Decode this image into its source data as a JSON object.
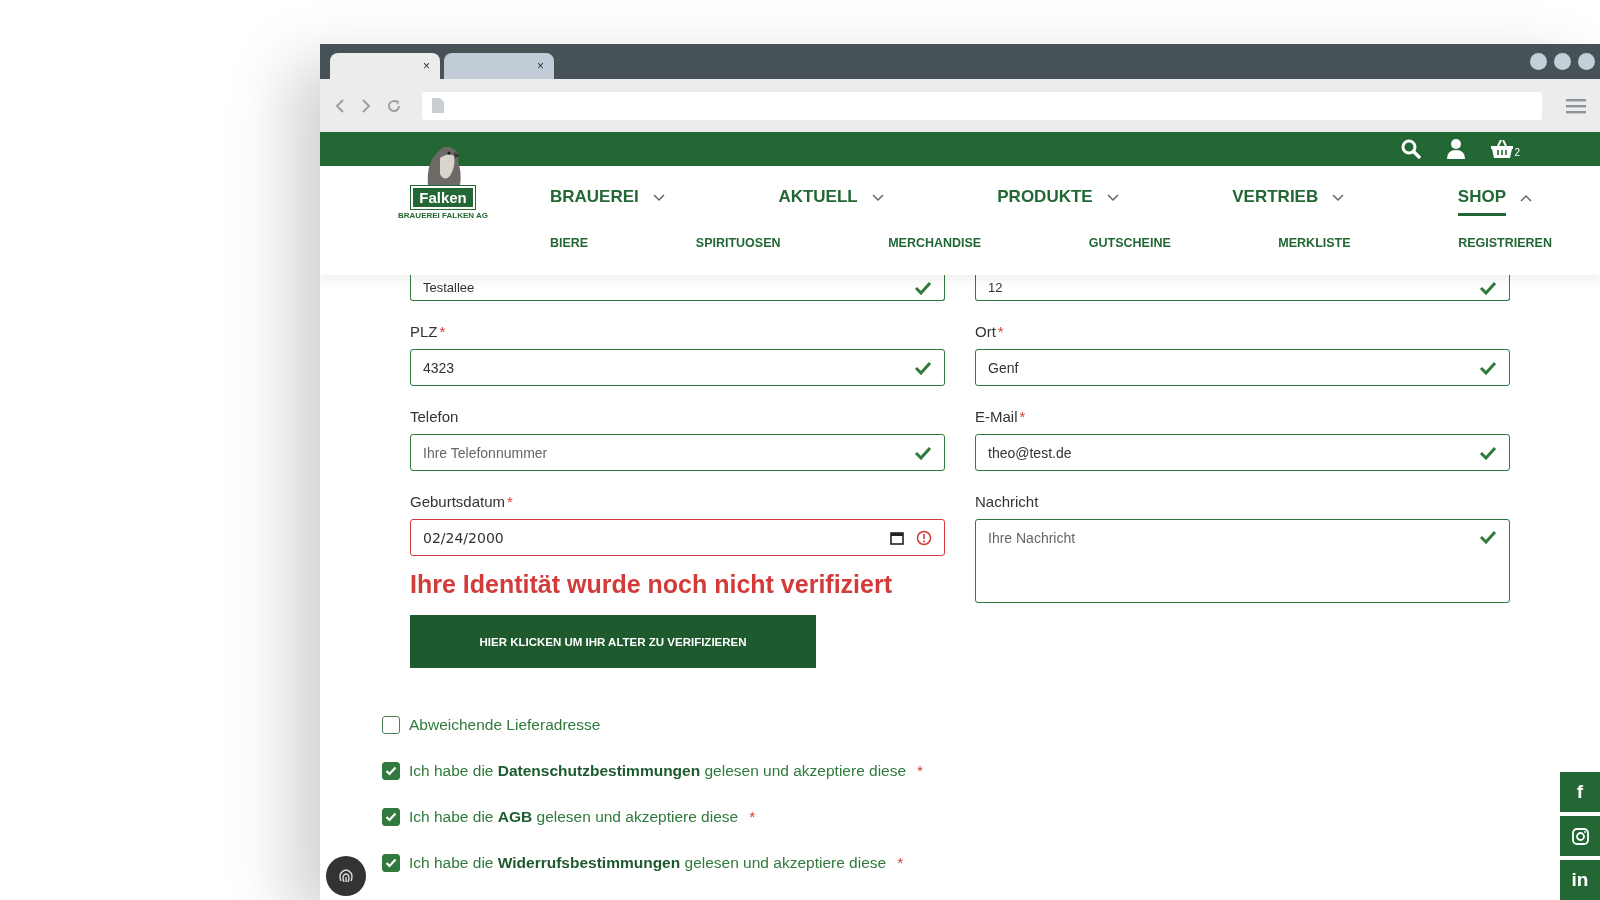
{
  "browser": {
    "tabs": [
      {
        "close": "×",
        "selected": true
      },
      {
        "close": "×",
        "selected": false
      }
    ]
  },
  "topbar": {
    "cart_count": "2"
  },
  "logo": {
    "name": "Falken",
    "subtitle": "BRAUEREI FALKEN AG"
  },
  "nav": [
    {
      "label": "BRAUEREI",
      "expanded": false,
      "selected": false
    },
    {
      "label": "AKTUELL",
      "expanded": false,
      "selected": false
    },
    {
      "label": "PRODUKTE",
      "expanded": false,
      "selected": false
    },
    {
      "label": "VERTRIEB",
      "expanded": false,
      "selected": false
    },
    {
      "label": "SHOP",
      "expanded": true,
      "selected": true
    }
  ],
  "subnav": [
    "BIERE",
    "SPIRITUOSEN",
    "MERCHANDISE",
    "GUTSCHEINE",
    "MERKLISTE",
    "REGISTRIEREN"
  ],
  "fields": [
    {
      "kind": "cut",
      "value": "Testallee",
      "valid": true
    },
    {
      "kind": "cut",
      "value": "12",
      "valid": true
    },
    {
      "kind": "text",
      "label": "PLZ",
      "required_mark": "*",
      "value": "4323",
      "valid": true
    },
    {
      "kind": "text",
      "label": "Ort",
      "required_mark": "*",
      "value": "Genf",
      "valid": true
    },
    {
      "kind": "text",
      "label": "Telefon",
      "placeholder": "Ihre Telefonnummer",
      "valid": true
    },
    {
      "kind": "text",
      "label": "E-Mail",
      "required_mark": "*",
      "value": "theo@test.de",
      "valid": true
    },
    {
      "kind": "date",
      "label": "Geburtsdatum",
      "required_mark": "*",
      "value": "02/24/2000",
      "valid": false
    },
    {
      "kind": "textarea",
      "label": "Nachricht",
      "placeholder": "Ihre Nachricht",
      "valid": true
    }
  ],
  "verification": {
    "message": "Ihre Identität wurde noch nicht verifiziert",
    "button": "HIER KLICKEN UM IHR ALTER ZU VERIFIZIEREN"
  },
  "checkboxes": [
    {
      "label": "Abweichende Lieferadresse",
      "checked": false
    },
    {
      "label": "Ich habe die **Datenschutzbestimmungen** gelesen und akzeptiere diese",
      "checked": true,
      "required_mark": "*"
    },
    {
      "label": "Ich habe die **AGB** gelesen und akzeptiere diese",
      "checked": true,
      "required_mark": "*"
    },
    {
      "label": "Ich habe die **Widerrufsbestimmungen** gelesen und akzeptiere diese",
      "checked": true,
      "required_mark": "*"
    }
  ],
  "social": [
    {
      "kind": "facebook",
      "glyph": "f"
    },
    {
      "kind": "instagram"
    },
    {
      "kind": "linkedin",
      "glyph": "in"
    }
  ]
}
